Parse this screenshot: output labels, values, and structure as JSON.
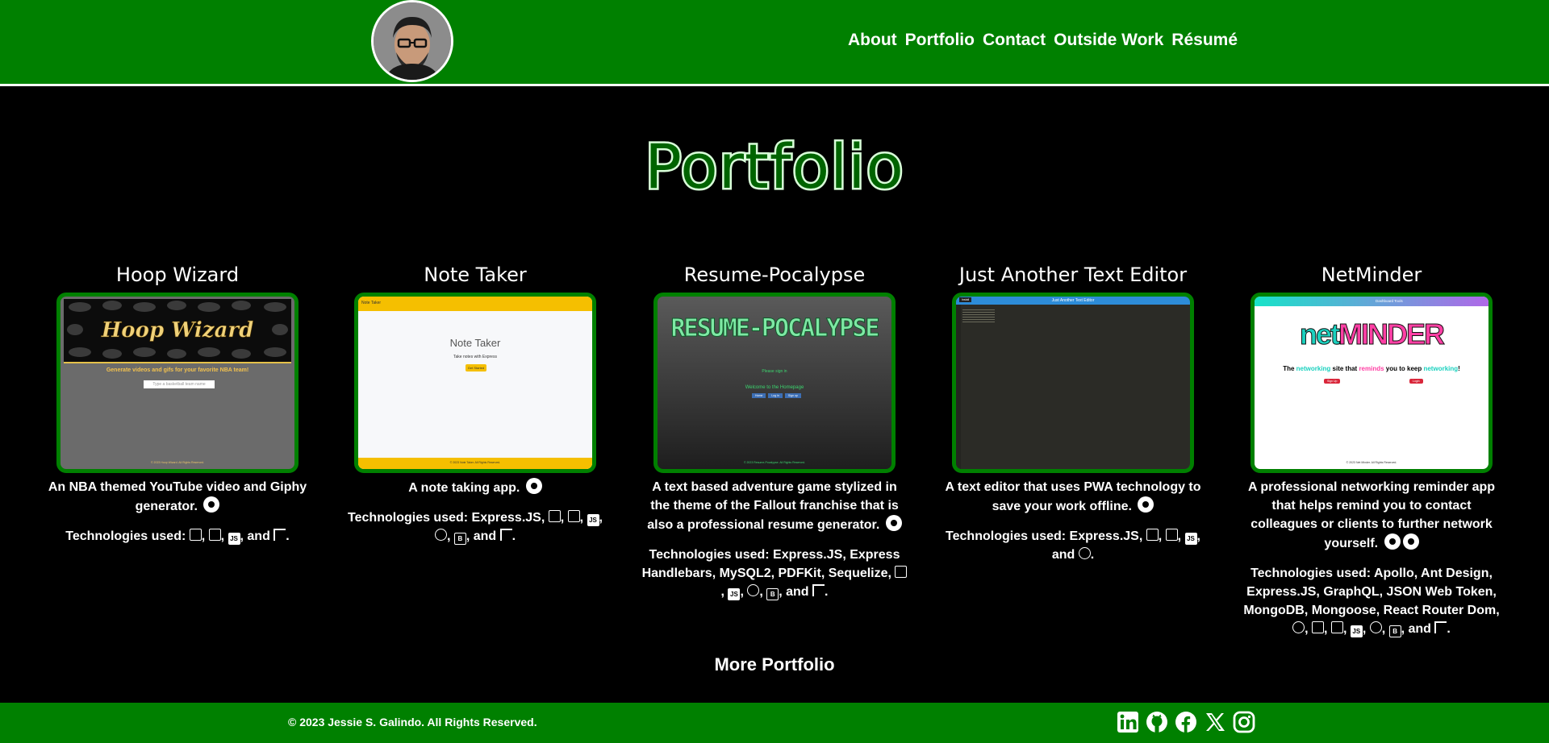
{
  "header": {
    "nav": [
      "About",
      "Portfolio",
      "Contact",
      "Outside Work",
      "Résumé"
    ]
  },
  "page_title": "Portfolio",
  "projects": [
    {
      "title": "Hoop Wizard",
      "desc": "An NBA themed YouTube video and Giphy generator.",
      "tech": "Technologies used: ",
      "shot": {
        "banner": "Hoop Wizard",
        "tagline": "Generate videos and gifs for your favorite NBA team!",
        "placeholder": "Type a basketball team name",
        "footer": "© 2023 Hoop Wizard. All Rights Reserved."
      }
    },
    {
      "title": "Note Taker",
      "desc": "A note taking app.",
      "tech": "Technologies used: Express.JS, ",
      "shot": {
        "topbar": "Note Taker",
        "heading": "Note Taker",
        "sub": "Take notes with Express",
        "button": "Get Started",
        "footer": "© 2023 Note Taker. All Rights Reserved."
      }
    },
    {
      "title": "Resume-Pocalypse",
      "desc": "A text based adventure game stylized in the theme of the Fallout franchise that is also a professional resume generator.",
      "tech": "Technologies used: Express.JS, Express Handlebars, MySQL2, PDFKit, Sequelize, ",
      "shot": {
        "logo": "RESUME-POCALYPSE",
        "login": "Please sign in",
        "welcome": "Welcome to the Homepage",
        "buttons": [
          "Home",
          "Log in",
          "Sign up"
        ],
        "footer": "© 2023 Resume-Pocalypse. All Rights Reserved."
      }
    },
    {
      "title": "Just Another Text Editor",
      "desc": "A text editor that uses PWA technology to save your work offline.",
      "tech": "Technologies used: Express.JS, ",
      "shot": {
        "topbar": "Just Another Text Editor",
        "install": "Install"
      }
    },
    {
      "title": "NetMinder",
      "desc": "A professional networking reminder app that helps remind you to contact colleagues or clients to further network yourself.",
      "tech": "Technologies used: Apollo, Ant Design, Express.JS, GraphQL, JSON Web Token, MongoDB, Mongoose, React Router Dom, ",
      "shot": {
        "topbar": "Dashboard Tools",
        "logo_a": "net",
        "logo_b": "MINDER",
        "tag_1": "The ",
        "tag_2": "networking",
        "tag_3": " site that ",
        "tag_4": "reminds",
        "tag_5": " you to keep ",
        "tag_6": "networking",
        "tag_7": "!",
        "btn_1": "Sign Up",
        "btn_2": "Login",
        "footer": "© 2023 Net Minder. All Rights Reserved."
      }
    }
  ],
  "tech_icons": {
    "html": "HTML5 icon",
    "css": "CSS3 icon",
    "js": "JS",
    "node": "Node.js icon",
    "bootstrap": "B",
    "flag": "Flag icon",
    "react": "React icon"
  },
  "conj": {
    "comma": ", ",
    "and": " and ",
    "comma_and": ", and ",
    "period": "."
  },
  "more_link": "More Portfolio",
  "footer": {
    "copyright": "© 2023 Jessie S. Galindo. All Rights Reserved.",
    "social": [
      "linkedin-icon",
      "github-icon",
      "facebook-icon",
      "x-icon",
      "instagram-icon"
    ]
  },
  "colors": {
    "brand_green": "#008000",
    "title_fill": "#006400",
    "background": "#000000",
    "text": "#ffffff"
  }
}
